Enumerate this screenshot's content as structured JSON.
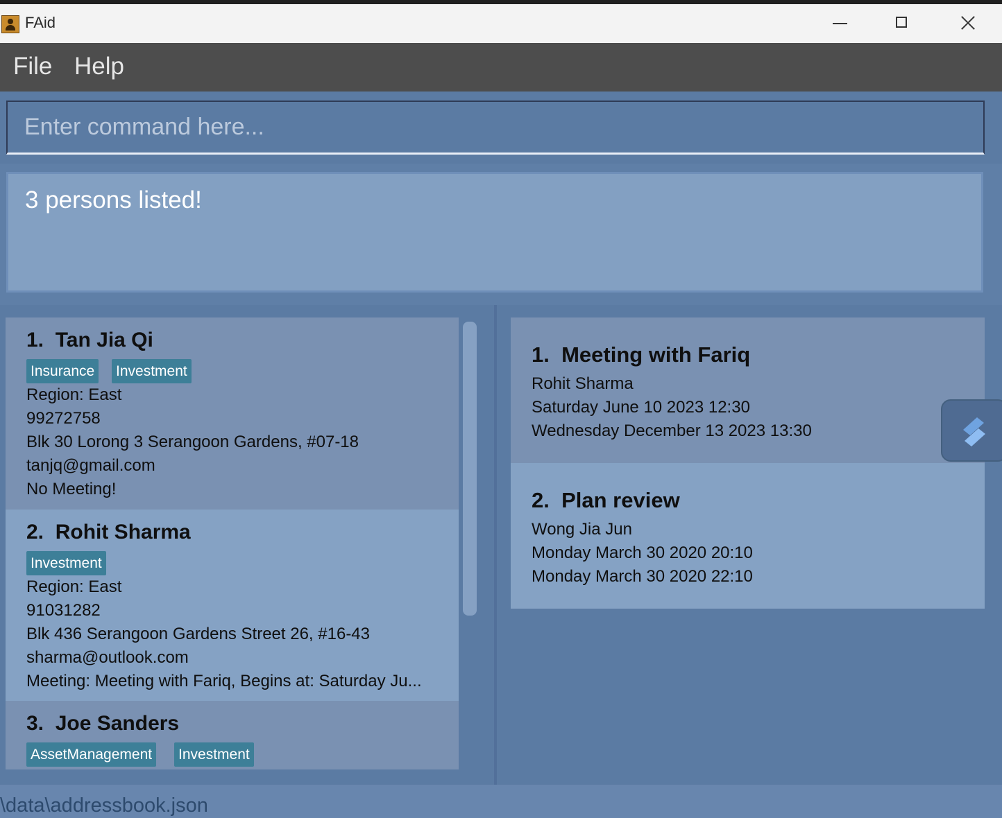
{
  "window": {
    "title": "FAid",
    "app_icon": "contacts-icon",
    "controls": {
      "minimize": "minimize-icon",
      "maximize": "maximize-icon",
      "close": "close-icon"
    }
  },
  "menu": {
    "file": "File",
    "help": "Help"
  },
  "command": {
    "placeholder": "Enter command here...",
    "value": ""
  },
  "result": {
    "message": "3 persons listed!"
  },
  "persons": [
    {
      "index": "1.",
      "name": "Tan Jia Qi",
      "tags": [
        "Insurance",
        "Investment"
      ],
      "region": "Region: East",
      "phone": "99272758",
      "address": "Blk 30 Lorong 3 Serangoon Gardens, #07-18",
      "email": "tanjq@gmail.com",
      "meeting": "No Meeting!"
    },
    {
      "index": "2.",
      "name": "Rohit Sharma",
      "tags": [
        "Investment"
      ],
      "region": "Region: East",
      "phone": "91031282",
      "address": "Blk 436 Serangoon Gardens Street 26, #16-43",
      "email": "sharma@outlook.com",
      "meeting": "Meeting: Meeting with Fariq, Begins at: Saturday Ju..."
    },
    {
      "index": "3.",
      "name": "Joe Sanders",
      "tags": [
        "AssetManagement",
        "Investment"
      ]
    }
  ],
  "meetings": [
    {
      "index": "1.",
      "title": "Meeting with Fariq",
      "attendee": "Rohit Sharma",
      "start": "Saturday June 10 2023 12:30",
      "end": "Wednesday December 13 2023 13:30"
    },
    {
      "index": "2.",
      "title": "Plan review",
      "attendee": "Wong Jia Jun",
      "start": "Monday March 30 2020 20:10",
      "end": "Monday March 30 2020 22:10"
    }
  ],
  "status": {
    "path": "\\data\\addressbook.json"
  },
  "colors": {
    "tag": "#3d7f98",
    "background": "#5b7ba3",
    "card_dark": "#7a91b2",
    "card_light": "#85a2c4",
    "menubar": "#4d4d4d"
  },
  "floating_widget": {
    "icon": "stylus-icon"
  }
}
